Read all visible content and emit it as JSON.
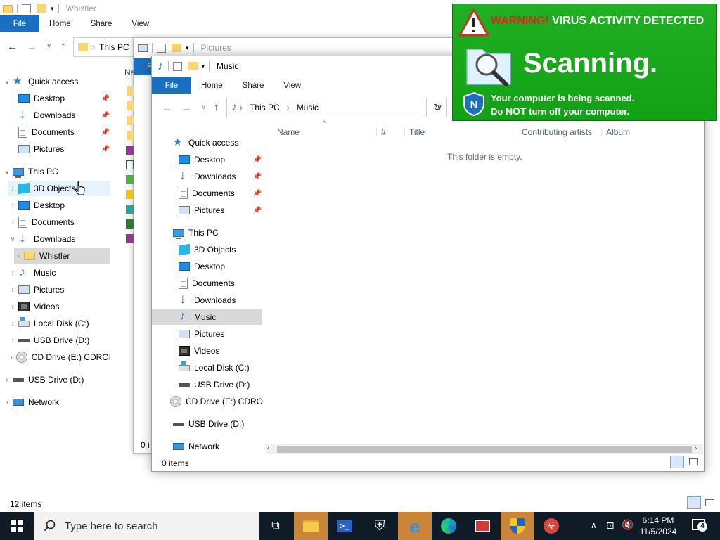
{
  "back_window": {
    "title": "Whistler",
    "ribbon": {
      "file": "File",
      "tabs": [
        "Home",
        "Share",
        "View"
      ]
    },
    "address": "This PC",
    "nav": {
      "quick_access": "Quick access",
      "qa_items": [
        "Desktop",
        "Downloads",
        "Documents",
        "Pictures"
      ],
      "this_pc": "This PC",
      "pc_items": [
        "3D Objects",
        "Desktop",
        "Documents",
        "Downloads",
        "Whistler",
        "Music",
        "Pictures",
        "Videos",
        "Local Disk (C:)",
        "USB Drive (D:)",
        "CD Drive (E:) CDROI"
      ],
      "usb": "USB Drive (D:)",
      "network": "Network"
    },
    "status": "12 items"
  },
  "mid_window": {
    "title": "Pictures",
    "col_hint": "Na",
    "ribbon_file": "F",
    "status": "0 i"
  },
  "front_window": {
    "title": "Music",
    "ribbon": {
      "file": "File",
      "tabs": [
        "Home",
        "Share",
        "View"
      ]
    },
    "address": {
      "root": "This PC",
      "current": "Music"
    },
    "columns": [
      "Name",
      "#",
      "Title",
      "Contributing artists",
      "Album"
    ],
    "empty_message": "This folder is empty.",
    "nav": {
      "quick_access": "Quick access",
      "qa_items": [
        "Desktop",
        "Downloads",
        "Documents",
        "Pictures"
      ],
      "this_pc": "This PC",
      "pc_items": [
        "3D Objects",
        "Desktop",
        "Documents",
        "Downloads",
        "Music",
        "Pictures",
        "Videos",
        "Local Disk (C:)",
        "USB Drive (D:)",
        "CD Drive (E:) CDROI"
      ],
      "usb": "USB Drive (D:)",
      "network": "Network"
    },
    "status": "0 items"
  },
  "warning": {
    "prefix": "WARNING!",
    "headline": " VIRUS ACTIVITY DETECTED",
    "scanning": "Scanning.",
    "line1": "Your computer is being scanned.",
    "line2_a": "Do ",
    "line2_b": "NOT",
    "line2_c": " turn off your computer.",
    "colors": {
      "bg": "#1aa81c",
      "prefix": "#e0241b"
    }
  },
  "taskbar": {
    "search_placeholder": "Type here to search",
    "time": "6:14 PM",
    "date": "11/5/2024",
    "notifications": "4"
  }
}
